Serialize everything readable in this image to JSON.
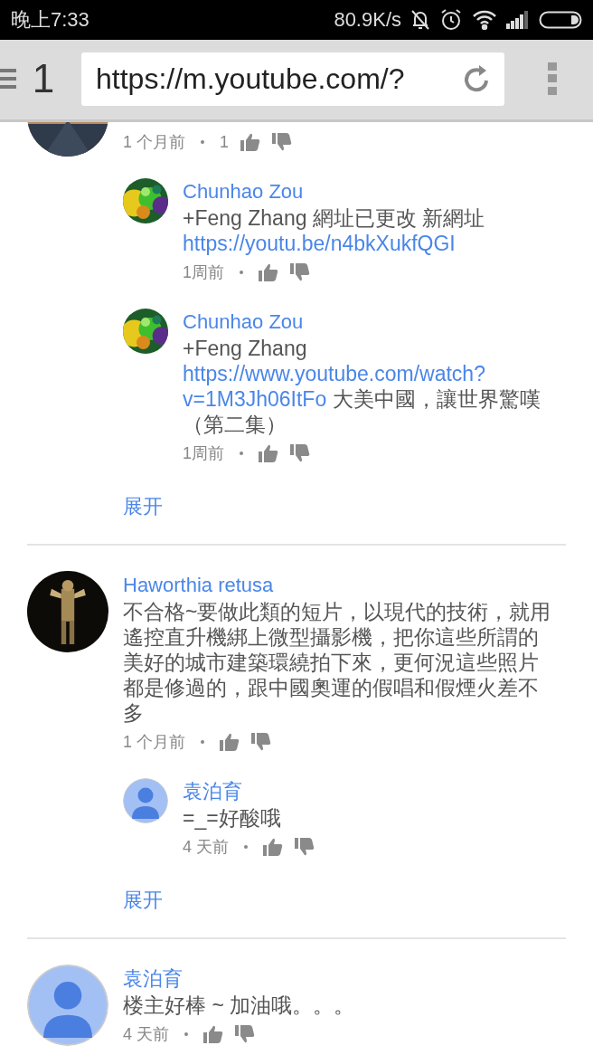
{
  "status_bar": {
    "time": "晚上7:33",
    "speed": "80.9K/s"
  },
  "toolbar": {
    "tab_count": "1",
    "url": "https://m.youtube.com/?"
  },
  "comments": [
    {
      "avatar": {
        "kind": "picture"
      },
      "time": "1 个月前",
      "likes": "1",
      "replies": [
        {
          "author": "Chunhao Zou",
          "avatar": {
            "kind": "picture"
          },
          "body": [
            {
              "kind": "text",
              "text": "+Feng Zhang 網址已更改 新網址"
            },
            {
              "kind": "link",
              "text": "https://youtu.be/n4bkXukfQGI"
            }
          ],
          "time": "1周前"
        },
        {
          "author": "Chunhao Zou",
          "avatar": {
            "kind": "picture"
          },
          "body": [
            {
              "kind": "text",
              "text": "+Feng Zhang"
            },
            {
              "kind": "link",
              "text": "https://www.youtube.com/watch?"
            },
            {
              "kind": "link",
              "text": "v=1M3Jh06ItFo"
            },
            {
              "kind": "text",
              "text": " 大美中國，讓世界驚嘆（第二集）"
            }
          ],
          "time": "1周前"
        }
      ],
      "show_more": "展开"
    },
    {
      "author": "Haworthia retusa",
      "avatar": {
        "kind": "picture"
      },
      "body": [
        {
          "kind": "text",
          "text": "不合格~要做此類的短片，以現代的技術，就用遙控直升機綁上微型攝影機，把你這些所謂的美好的城市建築環繞拍下來，更何況這些照片都是修過的，跟中國奧運的假唱和假煙火差不多"
        }
      ],
      "time": "1 个月前",
      "replies": [
        {
          "author": "袁泊育",
          "avatar": {
            "kind": "default"
          },
          "body": [
            {
              "kind": "text",
              "text": "=_=好酸哦"
            }
          ],
          "time": "4 天前"
        }
      ],
      "show_more": "展开"
    },
    {
      "author": "袁泊育",
      "avatar": {
        "kind": "default"
      },
      "body": [
        {
          "kind": "text",
          "text": "楼主好棒 ~ 加油哦。。。"
        }
      ],
      "time": "4 天前"
    }
  ]
}
